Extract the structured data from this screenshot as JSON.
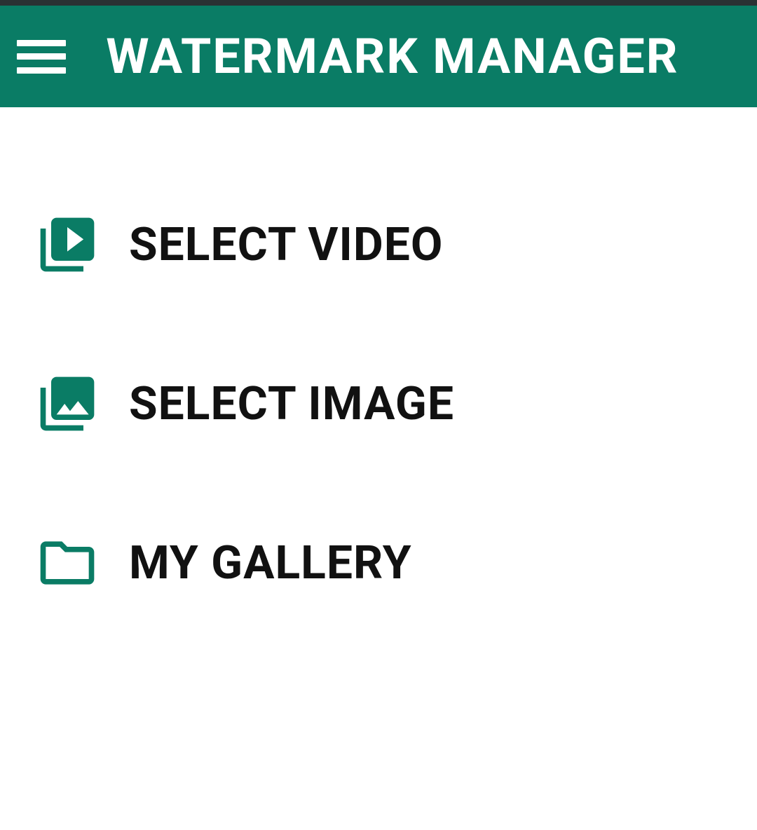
{
  "header": {
    "title": "WATERMARK MANAGER"
  },
  "menu": {
    "items": [
      {
        "label": "SELECT VIDEO",
        "icon": "video-library-icon"
      },
      {
        "label": "SELECT IMAGE",
        "icon": "image-library-icon"
      },
      {
        "label": "MY GALLERY",
        "icon": "folder-icon"
      }
    ]
  },
  "colors": {
    "primary": "#0a7c65",
    "text": "#111111",
    "bar": "#ffffff"
  }
}
